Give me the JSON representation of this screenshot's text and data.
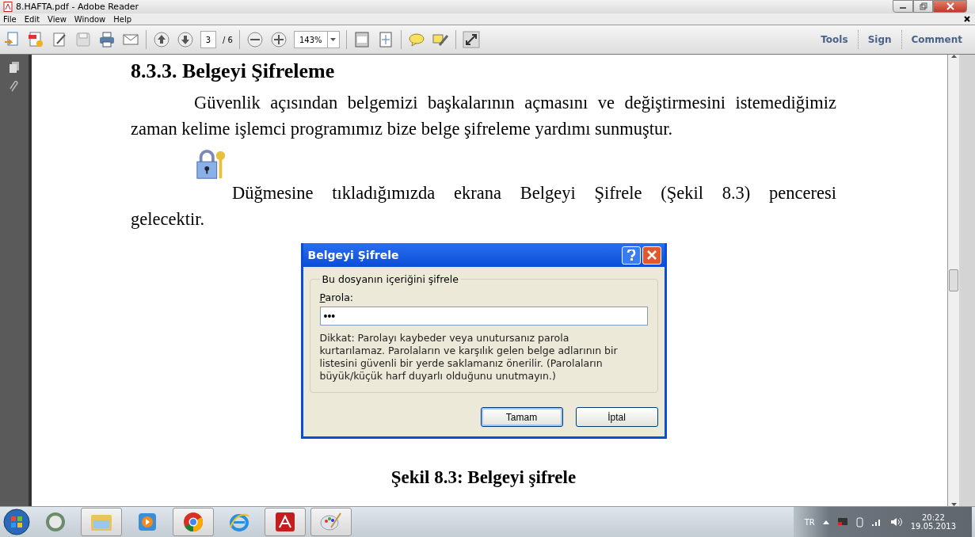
{
  "window": {
    "title": "8.HAFTA.pdf - Adobe Reader"
  },
  "menu": [
    "File",
    "Edit",
    "View",
    "Window",
    "Help"
  ],
  "toolbar": {
    "page": "3",
    "page_total": "/ 6",
    "zoom": "143%",
    "links": [
      "Tools",
      "Sign",
      "Comment"
    ]
  },
  "document": {
    "heading": "8.3.3. Belgeyi Şifreleme",
    "paragraph": "Güvenlik açısından belgemizi başkalarının açmasını ve değiştirmesini istemediğimiz zaman kelime işlemci programımız bize belge şifreleme yardımı sunmuştur.",
    "icon_paragraph": "Düğmesine tıkladığımızda ekrana Belgeyi Şifrele (Şekil 8.3) penceresi gelecektir.",
    "dialog": {
      "title": "Belgeyi Şifrele",
      "group": "Bu dosyanın içeriğini şifrele",
      "field_label": "Parola:",
      "field_value": "•••",
      "note": "Dikkat: Parolayı kaybeder veya unutursanız parola kurtarılamaz. Parolaların ve karşılık gelen belge adlarının bir listesini güvenli bir yerde saklamanız önerilir. (Parolaların büyük/küçük harf duyarlı olduğunu unutmayın.)",
      "buttons": [
        {
          "label": "Tamam",
          "default": true
        },
        {
          "label": "İptal",
          "default": false
        }
      ]
    },
    "caption": "Şekil 8.3: Belgeyi şifrele"
  },
  "taskbar": {
    "apps": [
      {
        "kind": "media",
        "open": false
      },
      {
        "kind": "folder",
        "open": true
      },
      {
        "kind": "player",
        "open": false
      },
      {
        "kind": "chrome",
        "open": true
      },
      {
        "kind": "ie",
        "open": false
      },
      {
        "kind": "acrobat",
        "open": true
      },
      {
        "kind": "paint",
        "open": true
      }
    ],
    "language": "TR",
    "time": "20:22",
    "date": "19.05.2013"
  }
}
